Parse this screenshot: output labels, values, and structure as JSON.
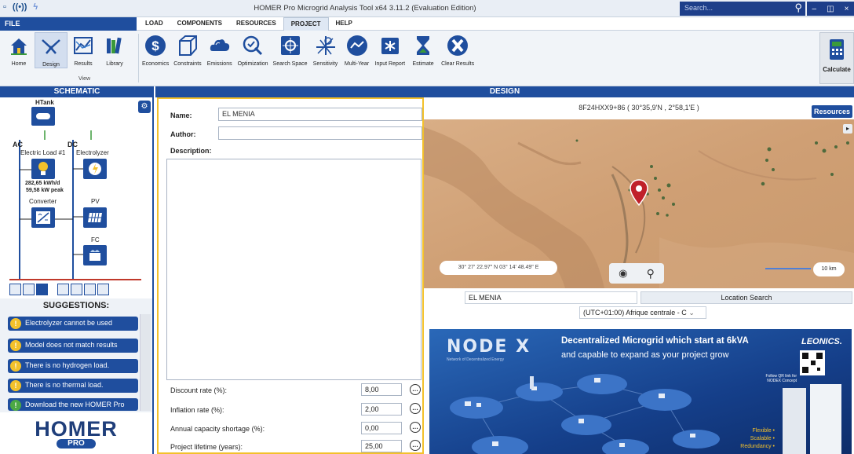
{
  "window": {
    "title": "HOMER Pro Microgrid Analysis Tool  x64 3.11.2 (Evaluation Edition)",
    "search_placeholder": "Search..."
  },
  "menu": {
    "file": "FILE",
    "tabs": [
      "LOAD",
      "COMPONENTS",
      "RESOURCES",
      "PROJECT",
      "HELP"
    ],
    "active_tab": "PROJECT"
  },
  "ribbon": {
    "view_buttons": [
      "Home",
      "Design",
      "Results",
      "Library"
    ],
    "view_group_label": "View",
    "project_buttons": [
      "Economics",
      "Constraints",
      "Emissions",
      "Optimization",
      "Search Space",
      "Sensitivity",
      "Multi-Year",
      "Input Report",
      "Estimate",
      "Clear Results"
    ],
    "calculate": "Calculate"
  },
  "headers": {
    "schematic": "SCHEMATIC",
    "design": "DESIGN"
  },
  "schematic": {
    "htank": "HTank",
    "ac": "AC",
    "dc": "DC",
    "electric_load": "Electric Load #1",
    "electrolyzer": "Electrolyzer",
    "load_kwh": "282,65 kWh/d",
    "load_peak": "59,58 kW peak",
    "converter": "Converter",
    "pv": "PV",
    "fc": "FC"
  },
  "suggestions": {
    "title": "SUGGESTIONS:",
    "items": [
      "Electrolyzer cannot be used",
      "Model does not match results",
      "There is no hydrogen load.",
      "There is no thermal load.",
      "Download the new HOMER Pro"
    ]
  },
  "logo": {
    "text": "HOMER",
    "sub": "PRO"
  },
  "form": {
    "name_label": "Name:",
    "name_value": "EL MENIA",
    "author_label": "Author:",
    "author_value": "",
    "description_label": "Description:",
    "params": [
      {
        "label": "Discount rate (%):",
        "value": "8,00"
      },
      {
        "label": "Inflation rate (%):",
        "value": "2,00"
      },
      {
        "label": "Annual capacity shortage (%):",
        "value": "0,00"
      },
      {
        "label": "Project lifetime (years):",
        "value": "25,00"
      }
    ],
    "param_button": "(..)"
  },
  "map": {
    "header": "8F24HXX9+86 ( 30°35,9'N , 2°58,1'E )",
    "resources_button": "Resources",
    "coords": "30° 27' 22.97\" N 03° 14' 48.49\" E",
    "scale": "10 km",
    "location_value": "EL MENIA",
    "location_search": "Location Search",
    "timezone": "(UTC+01:00) Afrique centrale - C"
  },
  "ad": {
    "brand": "NODE X",
    "brand_sub": "Network of Decentralized Energy",
    "headline_1": "Decentralized Microgrid which start at 6kVA",
    "headline_2": "and capable to expand as your project grow",
    "company": "LEONICS.",
    "qr_text": "Follow QR link for NODEX Concept",
    "features": [
      "Flexible •",
      "Scalable •",
      "Redundancy •"
    ]
  }
}
